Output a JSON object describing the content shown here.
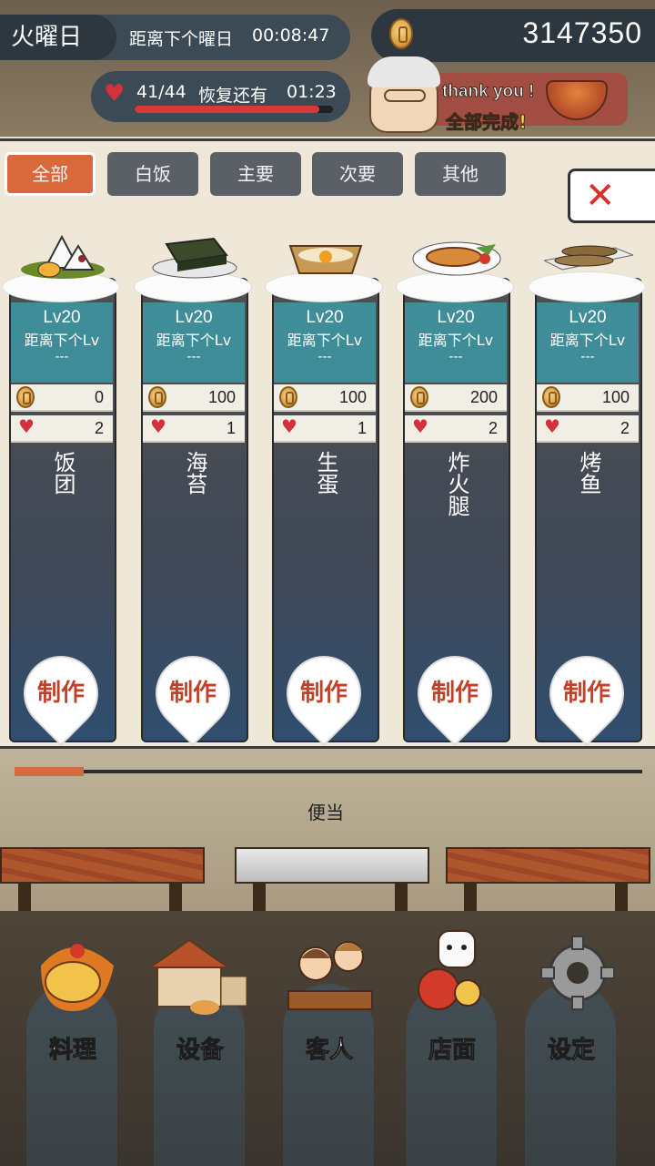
{
  "status": {
    "day": "火曜日",
    "countdown_label": "距离下个曜日",
    "countdown": "00:08:47",
    "coins": "3147350",
    "hp": "41/44",
    "hp_fraction": 0.93,
    "recover_label": "恢复还有",
    "recover_timer": "01:23"
  },
  "banner": {
    "thank_you": "thank you !",
    "all_done": "全部完成!"
  },
  "tabs": [
    {
      "label": "全部",
      "active": true
    },
    {
      "label": "白饭",
      "active": false
    },
    {
      "label": "主要",
      "active": false
    },
    {
      "label": "次要",
      "active": false
    },
    {
      "label": "其他",
      "active": false
    }
  ],
  "dishes": [
    {
      "name": "饭团",
      "lv": "Lv20",
      "next": "距离下个Lv",
      "dash": "---",
      "coin": "0",
      "heart": "2",
      "food": "onigiri"
    },
    {
      "name": "海苔",
      "lv": "Lv20",
      "next": "距离下个Lv",
      "dash": "---",
      "coin": "100",
      "heart": "1",
      "food": "seaweed"
    },
    {
      "name": "生蛋",
      "lv": "Lv20",
      "next": "距离下个Lv",
      "dash": "---",
      "coin": "100",
      "heart": "1",
      "food": "raw-egg"
    },
    {
      "name": "炸火腿",
      "lv": "Lv20",
      "next": "距离下个Lv",
      "dash": "---",
      "coin": "200",
      "heart": "2",
      "food": "fried-ham"
    },
    {
      "name": "烤鱼",
      "lv": "Lv20",
      "next": "距离下个Lv",
      "dash": "---",
      "coin": "100",
      "heart": "2",
      "food": "grilled-fish"
    }
  ],
  "make_label": "制作",
  "scroll_fraction": 0.11,
  "bento_label": "便当",
  "nav": [
    {
      "label": "料理",
      "icon": "cooking-icon"
    },
    {
      "label": "设备",
      "icon": "equipment-icon"
    },
    {
      "label": "客人",
      "icon": "customers-icon"
    },
    {
      "label": "店面",
      "icon": "storefront-icon"
    },
    {
      "label": "设定",
      "icon": "settings-gear-icon"
    }
  ],
  "colors": {
    "accent": "#d9683a",
    "card_head": "#3f8d99",
    "heart": "#d2333a",
    "make_text": "#c0422a"
  }
}
